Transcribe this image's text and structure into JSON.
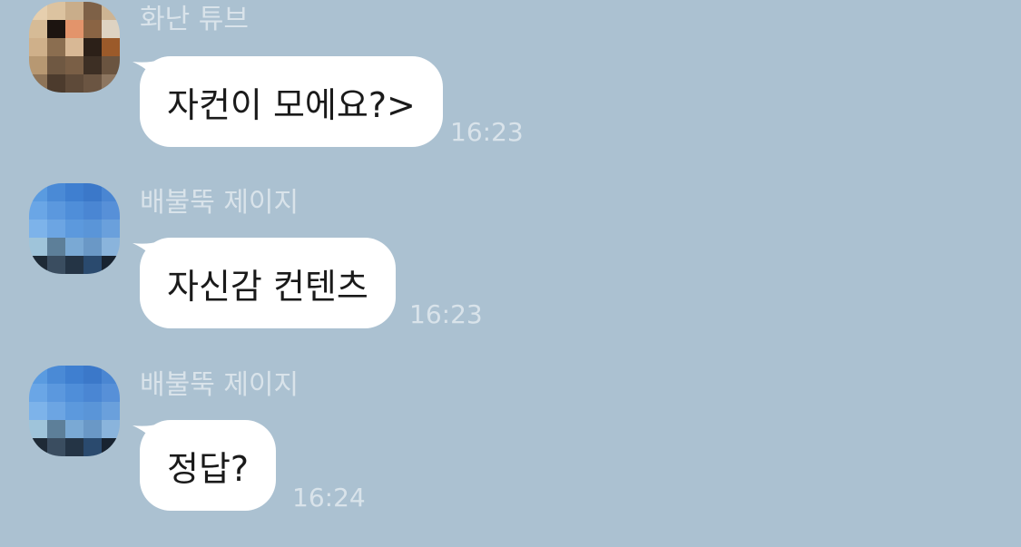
{
  "messages": [
    {
      "sender": "화난 튜브",
      "text": "자컨이 모에요?>",
      "time": "16:23",
      "avatar": "avatar-tan"
    },
    {
      "sender": "배불뚝 제이지",
      "text": "자신감 컨텐츠",
      "time": "16:23",
      "avatar": "avatar-blue"
    },
    {
      "sender": "배불뚝 제이지",
      "text": "정답?",
      "time": "16:24",
      "avatar": "avatar-blue"
    }
  ],
  "colors": {
    "background": "#abc1d1",
    "bubble": "#ffffff",
    "meta_text": "#d9e3ea"
  }
}
